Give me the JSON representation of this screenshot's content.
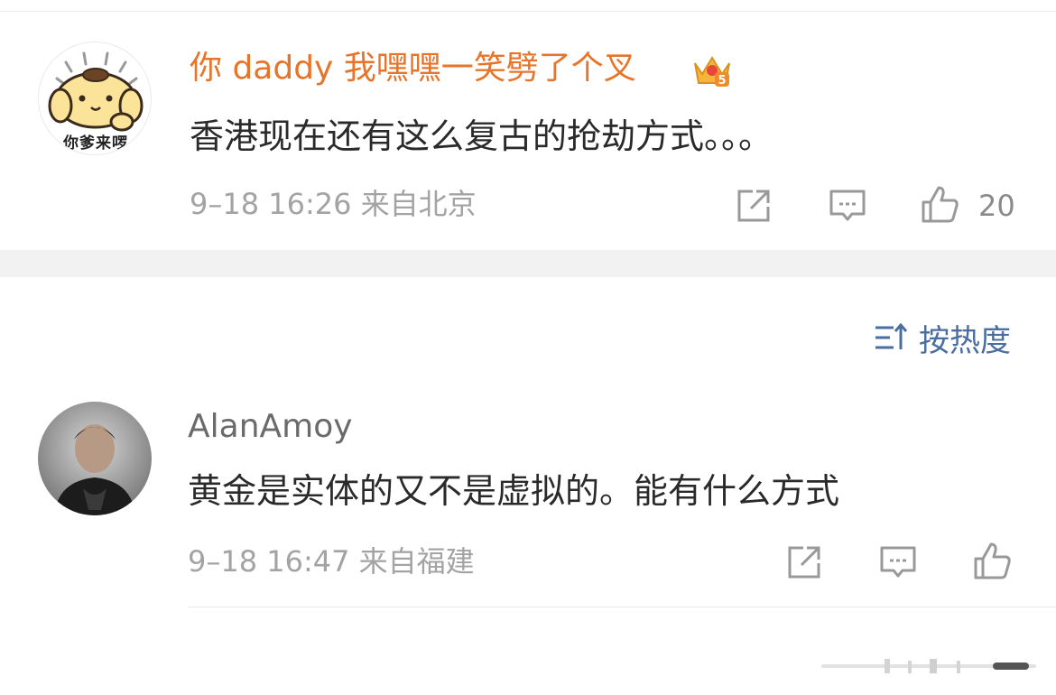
{
  "comments": [
    {
      "username": "你 daddy 我嘿嘿一笑劈了个叉",
      "avatar_caption": "你爹来啰",
      "badge_icon": "crown-badge-icon",
      "text": "香港现在还有这么复古的抢劫方式。。。",
      "meta": "9–18 16:26  来自北京",
      "like_count": "20",
      "username_color": "#e8742a"
    },
    {
      "username": "AlanAmoy",
      "text": "黄金是实体的又不是虚拟的。能有什么方式",
      "meta": "9–18 16:47  来自福建",
      "like_count": "",
      "username_color": "#6a6a6a"
    }
  ],
  "sort": {
    "label": "按热度",
    "icon": "sort-icon"
  },
  "colors": {
    "accent_orange": "#e8742a",
    "sort_blue": "#4a6ea0",
    "meta_gray": "#a3a3a3"
  }
}
